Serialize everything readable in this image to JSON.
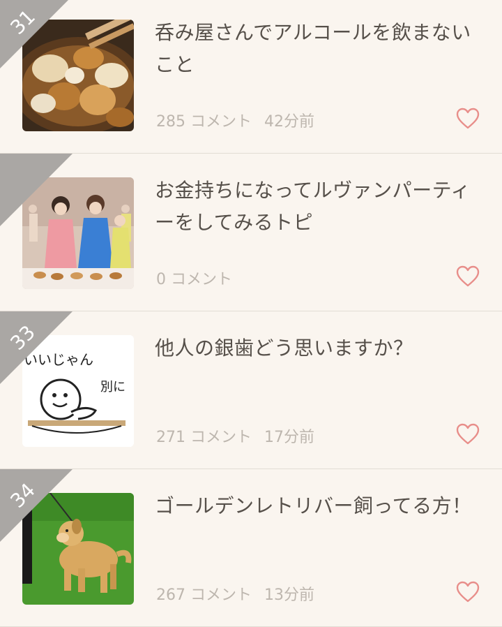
{
  "colors": {
    "background": "#faf5ef",
    "title_text": "#56504a",
    "meta_text": "#bdb6ae",
    "ribbon": "#aaa7a4",
    "heart": "#e88e8a"
  },
  "items": [
    {
      "rank": "31",
      "title": "呑み屋さんでアルコールを飲まないこと",
      "comments": "285 コメント",
      "time": "42分前",
      "icon": "heart-outline-icon"
    },
    {
      "rank": "",
      "title": "お金持ちになってルヴァンパーティーをしてみるトピ",
      "comments": "0 コメント",
      "time": "",
      "icon": "heart-outline-icon"
    },
    {
      "rank": "33",
      "title": "他人の銀歯どう思いますか？",
      "comments": "271 コメント",
      "time": "17分前",
      "icon": "heart-outline-icon",
      "thumb_text_1": "いいじゃん",
      "thumb_text_2": "別に"
    },
    {
      "rank": "34",
      "title": "ゴールデンレトリバー飼ってる方！",
      "comments": "267 コメント",
      "time": "13分前",
      "icon": "heart-outline-icon"
    }
  ]
}
